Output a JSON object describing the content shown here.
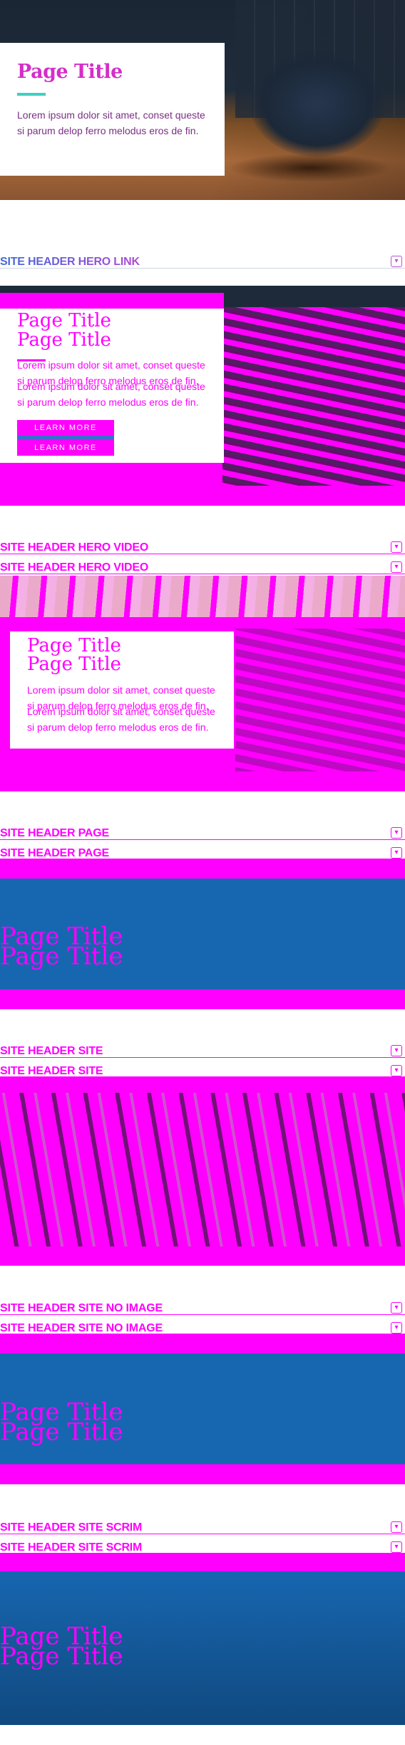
{
  "hero": {
    "title": "Page Title",
    "body": "Lorem ipsum dolor sit amet, conset queste si parum delop ferro melodus eros de fin."
  },
  "sections": {
    "hero_link": "SITE HEADER HERO LINK",
    "hero_video": "SITE HEADER HERO VIDEO",
    "page": "SITE HEADER PAGE",
    "site": "SITE HEADER SITE",
    "site_no_image": "SITE HEADER SITE NO IMAGE",
    "site_scrim": "SITE HEADER SITE SCRIM"
  },
  "toggle_glyph": "▾",
  "button_label": "LEARN MORE",
  "colors": {
    "accent_magenta": "#ff00ff",
    "title_pink": "#d42ec9",
    "rule_teal": "#3ed0c2",
    "header_blue": "#1766b0"
  }
}
